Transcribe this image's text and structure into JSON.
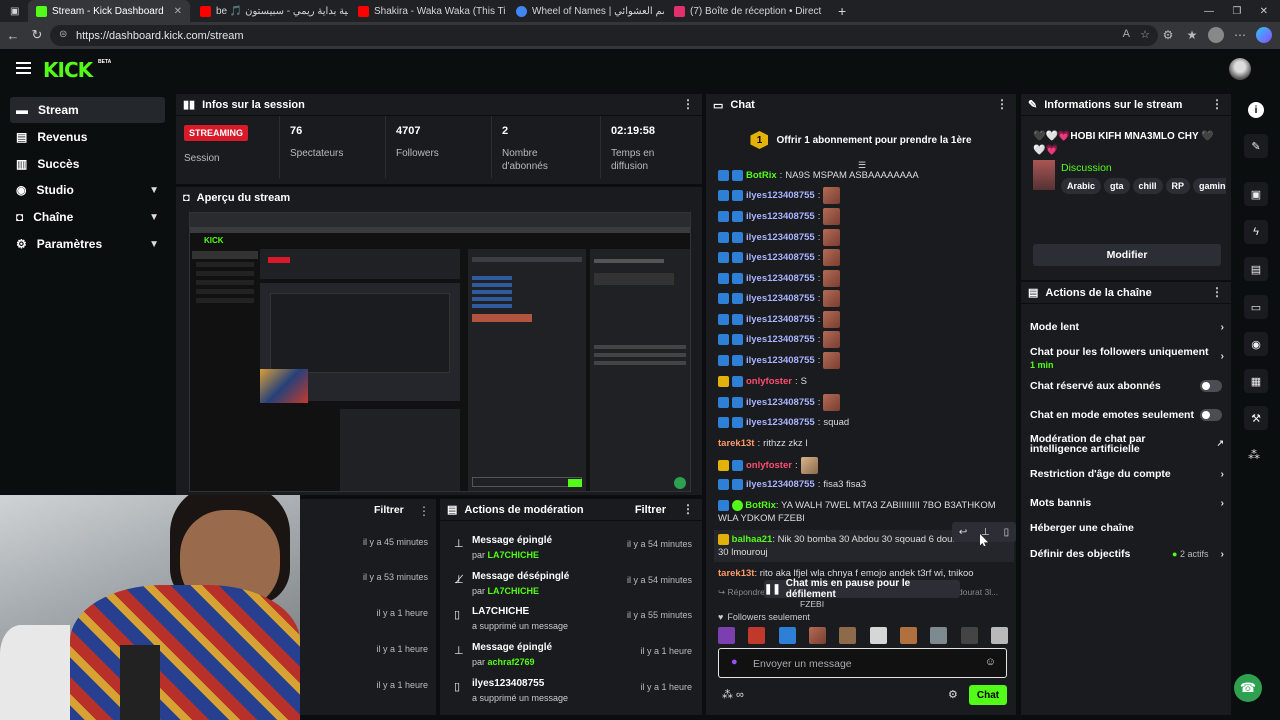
{
  "browser": {
    "tabs": [
      {
        "title": "Stream - Kick Dashboard",
        "color": "#53fc18"
      },
      {
        "title": "be 🎵 أغنية بداية ريمي - سبيستون",
        "color": "#ff0000"
      },
      {
        "title": "Shakira - Waka Waka (This Time F",
        "color": "#ff0000"
      },
      {
        "title": "Wheel of Names | الاسم العشوائي",
        "color": "#4285f4"
      },
      {
        "title": "(7) Boîte de réception • Direct",
        "color": "#e1306c"
      }
    ],
    "new_tab": "+",
    "url": "https://dashboard.kick.com/stream"
  },
  "app": {
    "logo": "KICK",
    "logo_beta": "BETA",
    "accent": "#53fc18"
  },
  "sidebar": {
    "items": [
      {
        "label": "Stream",
        "icon": "stream-icon"
      },
      {
        "label": "Revenus",
        "icon": "revenue-icon"
      },
      {
        "label": "Succès",
        "icon": "trophy-icon"
      },
      {
        "label": "Studio",
        "icon": "studio-icon"
      },
      {
        "label": "Chaîne",
        "icon": "channel-icon"
      },
      {
        "label": "Paramètres",
        "icon": "gear-icon"
      }
    ]
  },
  "session": {
    "title": "Infos sur la session",
    "badge": "STREAMING",
    "badge_sub": "Session",
    "stats": [
      {
        "value": "76",
        "label": "Spectateurs"
      },
      {
        "value": "4707",
        "label": "Followers"
      },
      {
        "value": "2",
        "label": "Nombre d'abonnés"
      },
      {
        "value": "02:19:58",
        "label": "Temps en diffusion"
      }
    ]
  },
  "preview": {
    "title": "Aperçu du stream"
  },
  "left_lower": {
    "filter": "Filtrer",
    "times": [
      "il y a 45 minutes",
      "il y a 53 minutes",
      "il y a 1 heure",
      "il y a 1 heure",
      "il y a 1 heure"
    ]
  },
  "moderation": {
    "title": "Actions de modération",
    "filter": "Filtrer",
    "rows": [
      {
        "title": "Message épinglé",
        "prefix": "par",
        "who": "LA7CHICHE",
        "time": "il y a 54 minutes",
        "icon": "pin-icon"
      },
      {
        "title": "Message désépinglé",
        "prefix": "par",
        "who": "LA7CHICHE",
        "time": "il y a 54 minutes",
        "icon": "unpin-icon"
      },
      {
        "title": "LA7CHICHE",
        "prefix": "a supprimé un message",
        "who": "",
        "time": "il y a 55 minutes",
        "icon": "trash-icon"
      },
      {
        "title": "Message épinglé",
        "prefix": "par",
        "who": "achraf2769",
        "time": "il y a 1 heure",
        "icon": "pin-icon"
      },
      {
        "title": "ilyes123408755",
        "prefix": "a supprimé un message",
        "who": "",
        "time": "il y a 1 heure",
        "icon": "trash-icon"
      }
    ]
  },
  "chat": {
    "title": "Chat",
    "sub_promo": "Offrir 1 abonnement pour prendre la 1ère",
    "sub_count": "1",
    "top_partial": "NA9S MSPAM ASBAAAAAAAA",
    "lines": [
      {
        "user": "BotRix",
        "text": "",
        "color": "#53fc18"
      },
      {
        "user": "ilyes123408755",
        "text": "",
        "color": "#a9b4ff"
      },
      {
        "user": "ilyes123408755",
        "text": "",
        "color": "#a9b4ff"
      },
      {
        "user": "ilyes123408755",
        "text": "",
        "color": "#a9b4ff"
      },
      {
        "user": "ilyes123408755",
        "text": "",
        "color": "#a9b4ff"
      },
      {
        "user": "ilyes123408755",
        "text": "",
        "color": "#a9b4ff"
      },
      {
        "user": "ilyes123408755",
        "text": "",
        "color": "#a9b4ff"
      },
      {
        "user": "ilyes123408755",
        "text": "",
        "color": "#a9b4ff"
      },
      {
        "user": "ilyes123408755",
        "text": "",
        "color": "#a9b4ff"
      },
      {
        "user": "onlyfoster",
        "text": "S",
        "color": "#ff4d6d"
      },
      {
        "user": "ilyes123408755",
        "text": "",
        "color": "#a9b4ff"
      },
      {
        "user": "ilyes123408755",
        "text": "squad",
        "color": "#a9b4ff"
      },
      {
        "user": "tarek13t",
        "text": "rithzz zkz l",
        "color": "#ff9966"
      },
      {
        "user": "onlyfoster",
        "text": "",
        "color": "#ff4d6d"
      },
      {
        "user": "ilyes123408755",
        "text": "fisa3 fisa3",
        "color": "#a9b4ff"
      }
    ],
    "botrix_msg_user": "BotRix",
    "botrix_msg": "YA WALH 7WEL MTA3 ZABIIIIIIII 7BO B3ATHKOM WLA YDKOM FZEBI",
    "balhaa_user": "balhaa21",
    "balhaa_msg": "Nik 30 bomba 30 Abdou 30 sqouad 6 dourat 30 lmourouj",
    "tarek_user": "tarek13t",
    "tarek_msg": "rito aka lfjel wla chnya f emojo andek t3rf wi, tnikoo",
    "reply_partial": "Répondre",
    "reply_partial2": "dourat 3l...",
    "paused": "Chat mis en pause pour le défilement",
    "bottom_partial": "FZEBI",
    "followers_only": "Followers seulement",
    "input_placeholder": "Envoyer un message",
    "send": "Chat"
  },
  "stream_info": {
    "title": "Informations sur le stream",
    "stream_title": "🖤🤍💗HOBI KIFH MNA3MLO CHY 🖤🤍💗",
    "category": "Discussion",
    "tags": [
      "Arabic",
      "gta",
      "chill",
      "RP",
      "gaming"
    ],
    "edit": "Modifier"
  },
  "channel_actions": {
    "title": "Actions de la chaîne",
    "items": [
      {
        "label": "Mode lent",
        "sub": "",
        "control": "chevron"
      },
      {
        "label": "Chat pour les followers uniquement",
        "sub": "1 min",
        "control": "chevron"
      },
      {
        "label": "Chat réservé aux abonnés",
        "sub": "",
        "control": "toggle"
      },
      {
        "label": "Chat en mode emotes seulement",
        "sub": "",
        "control": "toggle"
      },
      {
        "label": "Modération de chat par intelligence artificielle",
        "sub": "",
        "control": "external"
      },
      {
        "label": "Restriction d'âge du compte",
        "sub": "",
        "control": "chevron"
      },
      {
        "label": "Mots bannis",
        "sub": "",
        "control": "chevron"
      },
      {
        "label": "Héberger une chaîne",
        "sub": "",
        "control": "none"
      },
      {
        "label": "Définir des objectifs",
        "sub": "",
        "control": "chevron",
        "badge": "2 actifs"
      }
    ]
  }
}
